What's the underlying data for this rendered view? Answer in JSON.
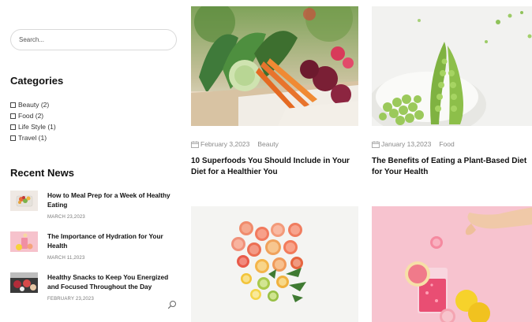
{
  "sidebar": {
    "search_placeholder": "Search...",
    "categories_title": "Categories",
    "categories": [
      {
        "label": "Beauty (2)"
      },
      {
        "label": "Food (2)"
      },
      {
        "label": "Life Style (1)"
      },
      {
        "label": "Travel (1)"
      }
    ],
    "recent_title": "Recent News",
    "recent": [
      {
        "title": "How to Meal Prep for a Week of Healthy Eating",
        "date": "MARCH 23,2023"
      },
      {
        "title": "The Importance of Hydration for Your Health",
        "date": "MARCH 11,2023"
      },
      {
        "title": "Healthy Snacks to Keep You Energized and Focused Throughout the Day",
        "date": "FEBRUARY 23,2023"
      }
    ]
  },
  "posts": [
    {
      "date": "February 3,2023",
      "category": "Beauty",
      "title": "10 Superfoods You Should Include in Your Diet for a Healthier You"
    },
    {
      "date": "January 13,2023",
      "category": "Food",
      "title": "The Benefits of Eating a Plant-Based Diet for Your Health"
    },
    {},
    {}
  ],
  "icons": {
    "calendar": "calendar-icon",
    "search": "magnifier-icon"
  },
  "colors": {
    "meta_text": "#8a8a8a",
    "pink_bg": "#f7c9d1",
    "border": "#d9d9d9"
  }
}
